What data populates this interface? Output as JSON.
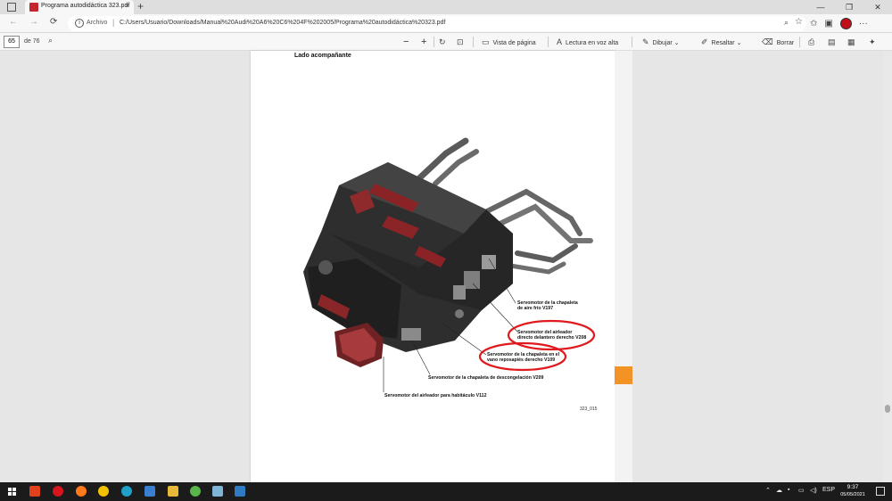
{
  "browser": {
    "tab_title": "Programa autodidáctica 323.pdf",
    "tab_close": "×",
    "new_tab": "+",
    "window_controls": [
      "—",
      "❐",
      "✕"
    ],
    "back": "←",
    "forward": "→",
    "reload": "⟳",
    "url_scheme": "Archivo",
    "url": "C:/Users/Usuario/Downloads/Manual%20Audi%20A6%20C6%204F%202005/Programa%20autodidáctica%20323.pdf",
    "more": "···",
    "accent_profile": "#c20e1a"
  },
  "pdf_toolbar": {
    "page_current": "65",
    "page_total": "de 76",
    "zoom_out": "−",
    "zoom_in": "+",
    "page_view": "Vista de página",
    "read_aloud": "Lectura en voz alta",
    "draw": "Dibujar",
    "highlight": "Resaltar",
    "erase": "Borrar"
  },
  "document": {
    "heading": "Lado acompañante",
    "figure_code": "323_015",
    "labels": {
      "l1": "Servomotor de la chapaleta\nde aire frío V197",
      "l2": "Servomotor del airleador\ndirecto delantero derecho V208",
      "l3": "Servomotor de la chapaleta en el\nvano reposapiés derecho V109",
      "l4": "Servomotor de la chapaleta de descongelación V209",
      "l5": "Servomotor del airleador para habitáculo V112"
    },
    "highlight_color": "#e0191e",
    "side_tab_color": "#f39225"
  },
  "taskbar": {
    "language": "ESP",
    "time": "9:37",
    "date": "05/05/2021",
    "notification_count": "1"
  }
}
